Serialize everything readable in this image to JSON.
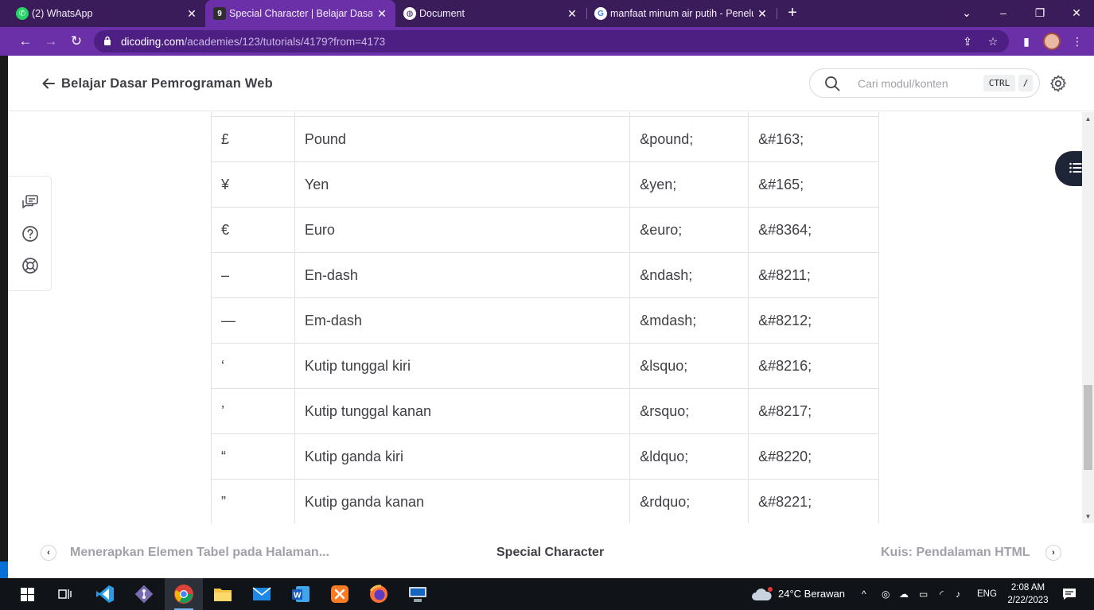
{
  "browser": {
    "tabs": [
      {
        "title": "(2) WhatsApp",
        "favicon": "whatsapp-icon",
        "active": false
      },
      {
        "title": "Special Character | Belajar Dasar P",
        "favicon": "dicoding-icon",
        "active": true
      },
      {
        "title": "Document",
        "favicon": "globe-icon",
        "active": false
      },
      {
        "title": "manfaat minum air putih - Penelu",
        "favicon": "google-icon",
        "active": false
      }
    ],
    "url_host": "dicoding.com",
    "url_path": "/academies/123/tutorials/4179?from=4173"
  },
  "header": {
    "course_title": "Belajar Dasar Pemrograman Web",
    "search_placeholder": "Cari modul/konten",
    "shortcut_key1": "CTRL",
    "shortcut_key2": "/"
  },
  "table": {
    "rows": [
      [
        "£",
        "Pound",
        "&pound;",
        "&#163;"
      ],
      [
        "¥",
        "Yen",
        "&yen;",
        "&#165;"
      ],
      [
        "€",
        "Euro",
        "&euro;",
        "&#8364;"
      ],
      [
        "–",
        "En-dash",
        "&ndash;",
        "&#8211;"
      ],
      [
        "—",
        "Em-dash",
        "&mdash;",
        "&#8212;"
      ],
      [
        "‘",
        "Kutip tunggal kiri",
        "&lsquo;",
        "&#8216;"
      ],
      [
        "’",
        "Kutip tunggal kanan",
        "&rsquo;",
        "&#8217;"
      ],
      [
        "“",
        "Kutip ganda kiri",
        "&ldquo;",
        "&#8220;"
      ],
      [
        "”",
        "Kutip ganda kanan",
        "&rdquo;",
        "&#8221;"
      ]
    ]
  },
  "bottom_nav": {
    "prev": "Menerapkan Elemen Tabel pada Halaman...",
    "current": "Special Character",
    "next": "Kuis: Pendalaman HTML"
  },
  "taskbar": {
    "weather": "24°C  Berawan",
    "lang": "ENG",
    "time": "2:08 AM",
    "date": "2/22/2023",
    "apps": [
      "windows-start-icon",
      "task-view-icon",
      "vscode-icon",
      "git-icon",
      "chrome-icon",
      "file-explorer-icon",
      "mail-icon",
      "word-icon",
      "xampp-icon",
      "firefox-icon",
      "network-app-icon"
    ]
  },
  "colors": {
    "tabbar": "#3b1c5a",
    "active_tab": "#6b2fa8",
    "toc_button": "#1e2537",
    "taskbar": "#101418"
  }
}
